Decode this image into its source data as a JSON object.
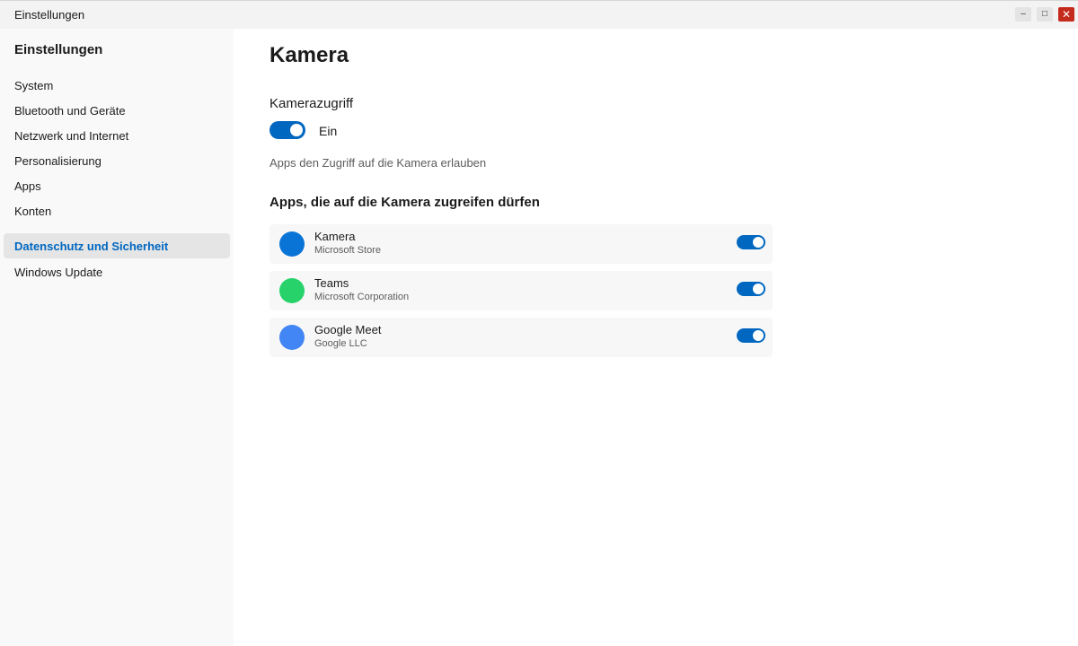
{
  "window": {
    "title": "Einstellungen",
    "controls": {
      "minimize": "–",
      "maximize": "□",
      "close": "✕"
    }
  },
  "sidebar": {
    "title": "Einstellungen",
    "items": [
      {
        "label": "System",
        "active": false
      },
      {
        "label": "Bluetooth und Geräte",
        "active": false
      },
      {
        "label": "Netzwerk und Internet",
        "active": false
      },
      {
        "label": "Personalisierung",
        "active": false
      },
      {
        "label": "Apps",
        "active": false
      },
      {
        "label": "Konten",
        "active": false
      },
      {
        "label": "Datenschutz und Sicherheit",
        "active": true
      },
      {
        "label": "Windows Update",
        "active": false
      }
    ]
  },
  "main": {
    "title": "Kamera",
    "access": {
      "label": "Kamerazugriff",
      "state_label": "Ein",
      "on": true,
      "description": "Apps den Zugriff auf die Kamera erlauben"
    },
    "apps_heading": "Apps, die auf die Kamera zugreifen dürfen",
    "apps": [
      {
        "name": "Kamera",
        "publisher": "Microsoft Store",
        "icon_color": "#0a74d6",
        "on": true
      },
      {
        "name": "Teams",
        "publisher": "Microsoft Corporation",
        "icon_color": "#27d26a",
        "on": true
      },
      {
        "name": "Google Meet",
        "publisher": "Google LLC",
        "icon_color": "#4285f4",
        "on": true
      }
    ]
  },
  "colors": {
    "accent": "#0067c0",
    "close_button": "#c42b1c"
  }
}
